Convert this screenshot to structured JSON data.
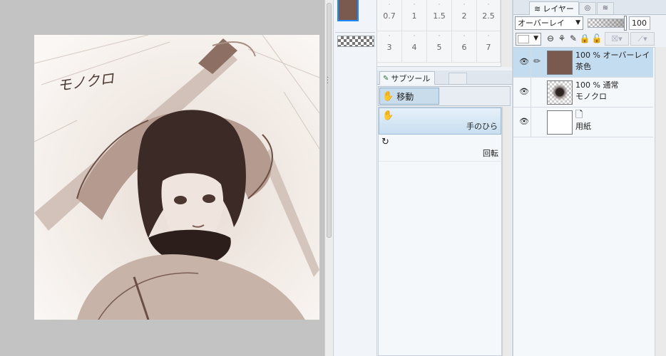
{
  "artwork": {
    "handwritten_title": "モノクロ"
  },
  "colors": {
    "main_color": "#7a5a4e",
    "accent_selection": "#c4dcef",
    "canvas_background": "#c3c3c3"
  },
  "brush_size": {
    "values": [
      "0.7",
      "1",
      "1.5",
      "2",
      "2.5",
      "3",
      "4",
      "5",
      "6",
      "7"
    ]
  },
  "subtool_panel": {
    "tab_label": "サブツール",
    "group_label": "移動",
    "items": [
      {
        "label": "手のひら",
        "icon": "hand-icon",
        "selected": true
      },
      {
        "label": "回転",
        "icon": "rotate-icon",
        "selected": false
      }
    ]
  },
  "layer_panel": {
    "tab_label": "レイヤー",
    "blend_mode": "オーバーレイ",
    "opacity_value": "100",
    "opacity_fraction": 1.0,
    "layers": [
      {
        "opacity": "100 %",
        "mode": "オーバーレイ",
        "name": "茶色",
        "selected": true,
        "visible": true,
        "thumb": "brown"
      },
      {
        "opacity": "100 %",
        "mode": "通常",
        "name": "モノクロ",
        "selected": false,
        "visible": true,
        "thumb": "sketch"
      },
      {
        "opacity": "",
        "mode": "",
        "name": "用紙",
        "selected": false,
        "visible": true,
        "thumb": "paper"
      }
    ]
  }
}
